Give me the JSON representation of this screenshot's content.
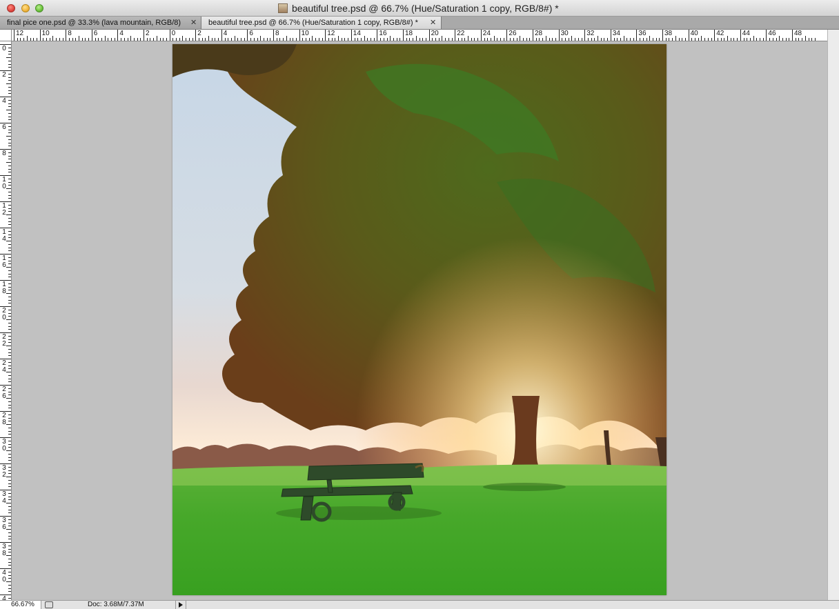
{
  "window": {
    "title": "beautiful tree.psd @ 66.7% (Hue/Saturation 1 copy, RGB/8#) *"
  },
  "tabs": [
    {
      "label": "final pice one.psd @ 33.3% (lava mountain, RGB/8)",
      "close": "✕",
      "active": false
    },
    {
      "label": "beautiful tree.psd @ 66.7% (Hue/Saturation 1 copy, RGB/8#) *",
      "close": "✕",
      "active": true
    }
  ],
  "rulers": {
    "horizontal_labels": [
      "12",
      "10",
      "8",
      "6",
      "4",
      "2",
      "0",
      "2",
      "4",
      "6",
      "8",
      "10",
      "12",
      "14",
      "16",
      "18",
      "20",
      "22",
      "24",
      "26",
      "28",
      "30",
      "32",
      "34",
      "36",
      "38",
      "40",
      "42",
      "44",
      "46",
      "48"
    ],
    "vertical_labels": [
      "0",
      "2",
      "4",
      "6",
      "8",
      "10",
      "12",
      "14",
      "16",
      "18",
      "20",
      "22",
      "24",
      "26",
      "28",
      "30",
      "32",
      "34",
      "36",
      "38",
      "40",
      "4"
    ]
  },
  "status": {
    "zoom": "66.67%",
    "doc_info": "Doc: 3.68M/7.37M"
  },
  "colors": {
    "grass": "#3fa52a",
    "sky_top": "#c8d8e8",
    "sunlight": "#fff2c8",
    "foliage": "#4a5a1e"
  }
}
